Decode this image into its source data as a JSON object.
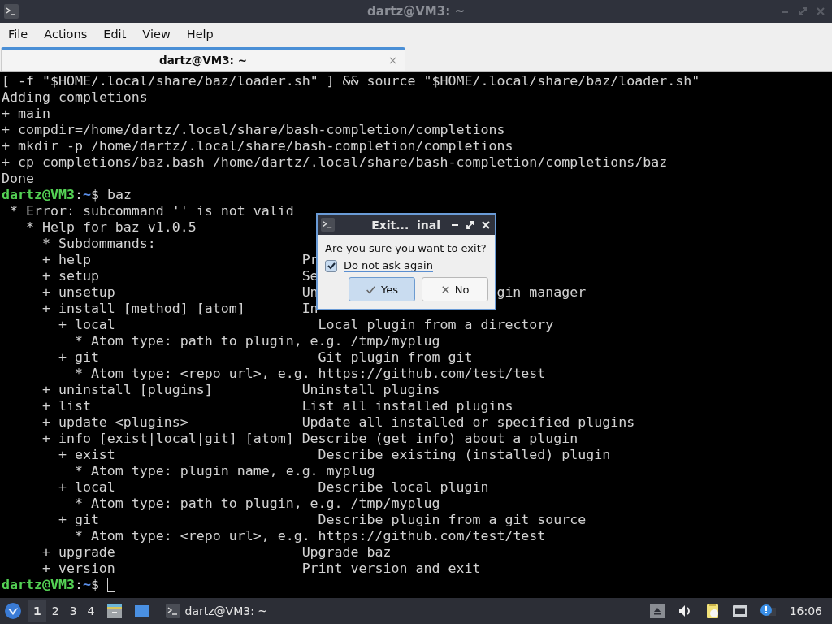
{
  "window": {
    "title": "dartz@VM3: ~"
  },
  "menu": [
    "File",
    "Actions",
    "Edit",
    "View",
    "Help"
  ],
  "tabs": [
    {
      "label": "dartz@VM3: ~",
      "selected": true
    }
  ],
  "terminal": {
    "lines": [
      {
        "kind": "output",
        "segments": [
          "[ -f \"$HOME/.local/share/baz/loader.sh\" ] && source \"$HOME/.local/share/baz/loader.sh\""
        ]
      },
      {
        "kind": "output",
        "segments": [
          "Adding completions"
        ]
      },
      {
        "kind": "output",
        "segments": [
          "+ main"
        ]
      },
      {
        "kind": "output",
        "segments": [
          "+ compdir=/home/dartz/.local/share/bash-completion/completions"
        ]
      },
      {
        "kind": "output",
        "segments": [
          "+ mkdir -p /home/dartz/.local/share/bash-completion/completions"
        ]
      },
      {
        "kind": "output",
        "segments": [
          "+ cp completions/baz.bash /home/dartz/.local/share/bash-completion/completions/baz"
        ]
      },
      {
        "kind": "output",
        "segments": [
          "Done"
        ]
      },
      {
        "kind": "prompt",
        "user": "dartz@VM3",
        "sep": ":",
        "path": "~",
        "symbol": "$",
        "command": "baz"
      },
      {
        "kind": "output",
        "segments": [
          " * Error: subcommand '' is not valid"
        ]
      },
      {
        "kind": "output",
        "segments": [
          "   * Help for baz v1.0.5"
        ]
      },
      {
        "kind": "output",
        "segments": [
          "     * Subdommands:"
        ]
      },
      {
        "kind": "output",
        "segments": [
          "     + help",
          "                          Pr"
        ]
      },
      {
        "kind": "output",
        "segments": [
          "     + setup",
          "                         Se"
        ]
      },
      {
        "kind": "output",
        "segments": [
          "     + unsetup",
          "                       Un",
          "                      gin manager"
        ]
      },
      {
        "kind": "output",
        "segments": [
          "     + install [method] [atom]",
          "       In"
        ]
      },
      {
        "kind": "output",
        "segments": [
          "       + local",
          "                         Local plugin from a directory"
        ]
      },
      {
        "kind": "output",
        "segments": [
          "         * Atom type: path to plugin, e.g. /tmp/myplug"
        ]
      },
      {
        "kind": "output",
        "segments": [
          "       + git",
          "                           Git plugin from git"
        ]
      },
      {
        "kind": "output",
        "segments": [
          "         * Atom type: <repo url>, e.g. https://github.com/test/test"
        ]
      },
      {
        "kind": "output",
        "segments": [
          "     + uninstall [plugins]",
          "           Uninstall plugins"
        ]
      },
      {
        "kind": "output",
        "segments": [
          "     + list",
          "                          List all installed plugins"
        ]
      },
      {
        "kind": "output",
        "segments": [
          "     + update <plugins>",
          "              Update all installed or specified plugins"
        ]
      },
      {
        "kind": "output",
        "segments": [
          "     + info [exist|local|git] [atom]",
          " Describe (get info) about a plugin"
        ]
      },
      {
        "kind": "output",
        "segments": [
          "       + exist",
          "                         Describe existing (installed) plugin"
        ]
      },
      {
        "kind": "output",
        "segments": [
          "         * Atom type: plugin name, e.g. myplug"
        ]
      },
      {
        "kind": "output",
        "segments": [
          "       + local",
          "                         Describe local plugin"
        ]
      },
      {
        "kind": "output",
        "segments": [
          "         * Atom type: path to plugin, e.g. /tmp/myplug"
        ]
      },
      {
        "kind": "output",
        "segments": [
          "       + git",
          "                           Describe plugin from a git source"
        ]
      },
      {
        "kind": "output",
        "segments": [
          "         * Atom type: <repo url>, e.g. https://github.com/test/test"
        ]
      },
      {
        "kind": "output",
        "segments": [
          "     + upgrade",
          "                       Upgrade baz"
        ]
      },
      {
        "kind": "output",
        "segments": [
          "     + version",
          "                       Print version and exit"
        ]
      },
      {
        "kind": "prompt",
        "user": "dartz@VM3",
        "sep": ":",
        "path": "~",
        "symbol": "$",
        "cursor": true
      }
    ]
  },
  "dialog": {
    "title": "Exit...  inal",
    "message": "Are you sure you want to exit?",
    "checkbox": {
      "label": "Do not ask again",
      "checked": true
    },
    "buttons": [
      {
        "label": "Yes",
        "kind": "yes",
        "selected": true
      },
      {
        "label": "No",
        "kind": "no",
        "selected": false
      }
    ]
  },
  "taskbar": {
    "workspaces": [
      {
        "label": "1",
        "selected": true
      },
      {
        "label": "2",
        "selected": false
      },
      {
        "label": "3",
        "selected": false
      },
      {
        "label": "4",
        "selected": false
      }
    ],
    "tasks": [
      {
        "label": "dartz@VM3: ~"
      }
    ],
    "clock": "16:06"
  }
}
